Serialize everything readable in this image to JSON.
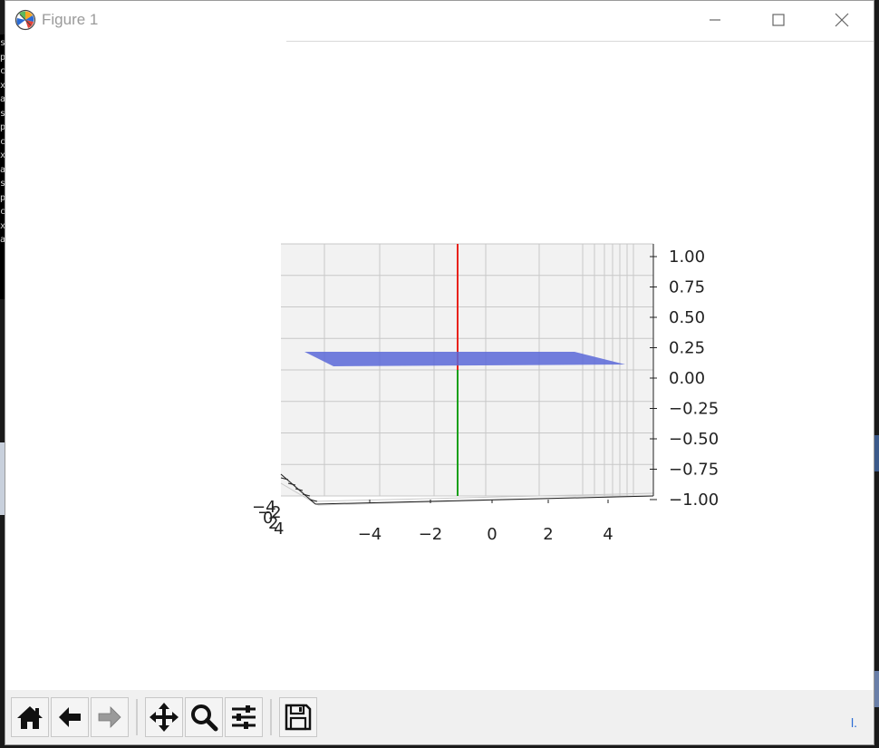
{
  "window": {
    "title": "Figure 1",
    "icon": "matplotlib-logo-icon",
    "controls": [
      "minimize-icon",
      "maximize-icon",
      "close-icon"
    ]
  },
  "background": {
    "terminal_chars": [
      "s",
      "p",
      "c",
      "x",
      "a",
      "s",
      "p",
      "c",
      "x",
      "a",
      "s",
      "p",
      "c",
      "x",
      "a"
    ]
  },
  "toolbar": {
    "buttons": [
      {
        "name": "home-button",
        "icon": "home-icon"
      },
      {
        "name": "back-button",
        "icon": "arrow-left-icon"
      },
      {
        "name": "forward-button",
        "icon": "arrow-right-icon"
      },
      {
        "name": "pan-button",
        "icon": "move-icon"
      },
      {
        "name": "zoom-button",
        "icon": "magnifier-icon"
      },
      {
        "name": "configure-subplots-button",
        "icon": "sliders-icon"
      },
      {
        "name": "save-button",
        "icon": "floppy-disk-icon"
      }
    ],
    "coord_readout": "l."
  },
  "colors": {
    "plane": "#5a68d8",
    "z_positive_line": "#e8231c",
    "z_negative_line": "#1aa01a",
    "pane": "#f2f2f2",
    "grid": "#c8c8c8"
  },
  "chart_data": {
    "type": "3d-surface",
    "title": "",
    "xlabel": "",
    "ylabel": "",
    "zlabel": "",
    "x_ticks": [
      "−4",
      "−2",
      "0",
      "2",
      "4"
    ],
    "y_ticks": [
      "−4",
      "−2",
      "0",
      "2",
      "4"
    ],
    "z_ticks": [
      "1.00",
      "0.75",
      "0.50",
      "0.25",
      "0.00",
      "−0.25",
      "−0.50",
      "−0.75",
      "−1.00"
    ],
    "xlim": [
      -5,
      5
    ],
    "ylim": [
      -5,
      5
    ],
    "zlim": [
      -1,
      1
    ],
    "grid": true,
    "surface": {
      "z": 0,
      "x_range": [
        -5,
        5
      ],
      "y_range": [
        -5,
        5
      ]
    },
    "lines": [
      {
        "x": 0,
        "y": 0,
        "z_range": [
          0,
          1
        ],
        "color": "red"
      },
      {
        "x": 0,
        "y": 0,
        "z_range": [
          -1,
          0
        ],
        "color": "green"
      }
    ]
  }
}
